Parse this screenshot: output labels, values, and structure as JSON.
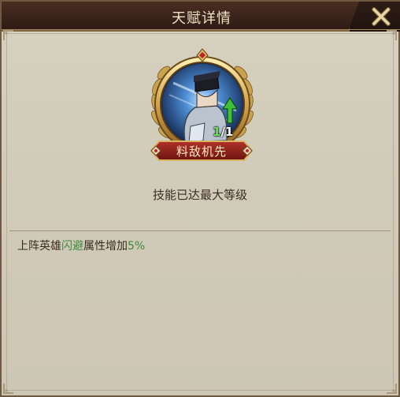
{
  "dialog": {
    "title": "天赋详情",
    "close_icon": "close-x-icon"
  },
  "talent": {
    "name": "料敌机先",
    "level_current": "1",
    "level_sep": "/",
    "level_max": "1",
    "status_text": "技能已达最大等级",
    "icon": "knight-hero-portrait-icon",
    "upgrade_icon": "green-up-arrow-icon"
  },
  "description": {
    "part1": "上阵英雄",
    "highlight": "闪避",
    "part2": "属性增加",
    "value": "5%"
  },
  "colors": {
    "highlight": "#3f8a3c",
    "title_bar": "#3b241b",
    "panel_bg": "#d1cbb9"
  }
}
